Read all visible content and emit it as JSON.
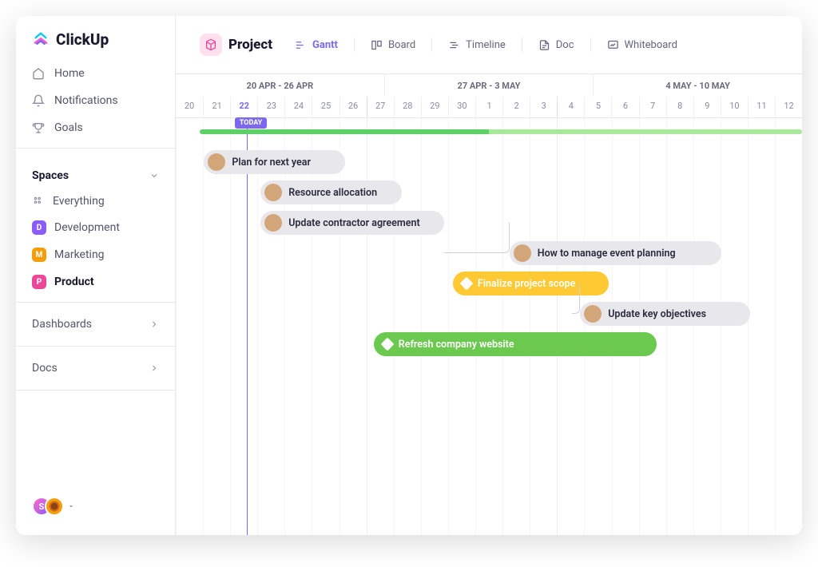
{
  "app_name": "ClickUp",
  "nav": {
    "home": "Home",
    "notifications": "Notifications",
    "goals": "Goals"
  },
  "spaces": {
    "header": "Spaces",
    "everything": "Everything",
    "items": [
      {
        "label": "Development",
        "badge": "D",
        "color": "#8b5cf6"
      },
      {
        "label": "Marketing",
        "badge": "M",
        "color": "#f59e0b"
      },
      {
        "label": "Product",
        "badge": "P",
        "color": "#ec4899",
        "active": true
      }
    ]
  },
  "menu": {
    "dashboards": "Dashboards",
    "docs": "Docs"
  },
  "topbar": {
    "project": "Project",
    "tabs": {
      "gantt": "Gantt",
      "board": "Board",
      "timeline": "Timeline",
      "doc": "Doc",
      "whiteboard": "Whiteboard"
    },
    "active_tab": "gantt"
  },
  "timeline": {
    "weeks": [
      "20 APR - 26 APR",
      "27 APR - 3 MAY",
      "4 MAY - 10 MAY"
    ],
    "days": [
      "20",
      "21",
      "22",
      "23",
      "24",
      "25",
      "26",
      "27",
      "28",
      "29",
      "30",
      "1",
      "2",
      "3",
      "4",
      "5",
      "6",
      "7",
      "8",
      "9",
      "10",
      "11",
      "12"
    ],
    "today_index": 2,
    "today_label": "TODAY",
    "week_separators": [
      7,
      14
    ]
  },
  "tasks": [
    {
      "label": "Plan for next year",
      "type": "gray",
      "avatar": true,
      "start": 1,
      "span": 5,
      "row": 0
    },
    {
      "label": "Resource allocation",
      "type": "gray",
      "avatar": true,
      "start": 3,
      "span": 5,
      "row": 1
    },
    {
      "label": "Update contractor agreement",
      "type": "gray",
      "avatar": true,
      "start": 3,
      "span": 6.5,
      "row": 2
    },
    {
      "label": "How to manage event planning",
      "type": "gray",
      "avatar": true,
      "start": 11.8,
      "span": 7.5,
      "row": 3
    },
    {
      "label": "Finalize project scope",
      "type": "yellow",
      "diamond": true,
      "start": 9.8,
      "span": 5.5,
      "row": 4
    },
    {
      "label": "Update key objectives",
      "type": "gray",
      "avatar": true,
      "start": 14.3,
      "span": 6,
      "row": 5
    },
    {
      "label": "Refresh company website",
      "type": "green",
      "diamond": true,
      "start": 7,
      "span": 10,
      "row": 6
    }
  ],
  "colors": {
    "primary": "#7b68ee",
    "green": "#6bc950",
    "yellow": "#ffc933",
    "pink": "#ec4899"
  },
  "chart_data": {
    "type": "gantt",
    "title": "Project Gantt",
    "date_range": {
      "start": "2020-04-20",
      "end": "2020-05-12"
    },
    "today": "2020-04-22",
    "tasks": [
      {
        "name": "Plan for next year",
        "start": "2020-04-21",
        "end": "2020-04-25",
        "status": "open"
      },
      {
        "name": "Resource allocation",
        "start": "2020-04-23",
        "end": "2020-04-27",
        "status": "open"
      },
      {
        "name": "Update contractor agreement",
        "start": "2020-04-23",
        "end": "2020-04-29",
        "status": "open"
      },
      {
        "name": "How to manage event planning",
        "start": "2020-05-02",
        "end": "2020-05-09",
        "status": "open"
      },
      {
        "name": "Finalize project scope",
        "start": "2020-04-30",
        "end": "2020-05-05",
        "status": "milestone"
      },
      {
        "name": "Update key objectives",
        "start": "2020-05-05",
        "end": "2020-05-10",
        "status": "open"
      },
      {
        "name": "Refresh company website",
        "start": "2020-04-27",
        "end": "2020-05-06",
        "status": "milestone"
      }
    ]
  },
  "avatars": {
    "bottom": [
      {
        "initial": "S"
      },
      {
        "initial": ""
      }
    ]
  }
}
